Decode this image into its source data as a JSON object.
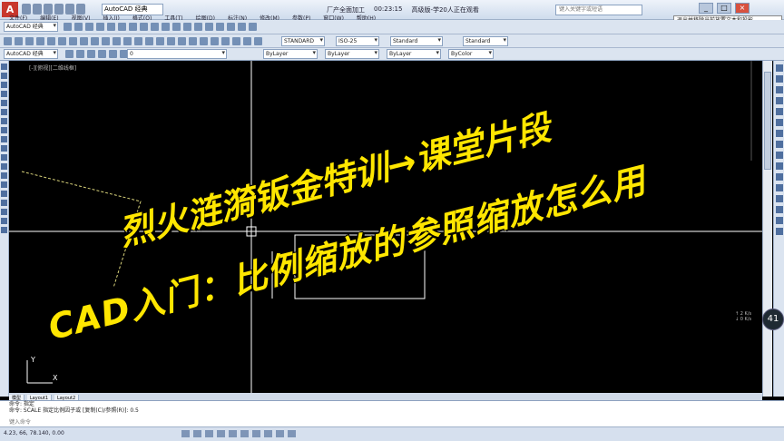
{
  "app": {
    "logo": "A",
    "workspace": "AutoCAD 经典",
    "doc_title": "厂产全面加工",
    "doc_meta": "00:23:15",
    "doc_info": "高级版-学20人正在观看",
    "search_placeholder": "键入关键字或短语",
    "menu": [
      "文件(F)",
      "编辑(E)",
      "视图(V)",
      "插入(I)",
      "格式(O)",
      "工具(T)",
      "绘图(D)",
      "标注(N)",
      "修改(M)",
      "参数(P)",
      "窗口(W)",
      "帮助(H)"
    ],
    "window_buttons": [
      "_",
      "□",
      "×"
    ]
  },
  "toolbars": {
    "workspace_combo": "AutoCAD 经典",
    "text_style": "STANDARD",
    "dim_style": "ISO-25",
    "table_style": "Standard",
    "multileader_style": "Standard",
    "layer": "0",
    "color": "ByLayer",
    "linetype": "ByLayer",
    "lineweight": "ByLayer",
    "plot_style": "ByColor"
  },
  "viewport": {
    "label": "[-][俯视][二维线框]"
  },
  "tooltip": "退出并移除当前放置文本和投影",
  "tabs": [
    "模型",
    "Layout1",
    "Layout2"
  ],
  "command": {
    "history": [
      "命令: 指定",
      "命令: SCALE 指定比例因子或 [复制(C)/参照(R)]: 0.5"
    ],
    "input_placeholder": "键入命令"
  },
  "status": {
    "coords": "4.23, 66, 78.140, 0.00"
  },
  "overlay": {
    "line1": "烈火涟漪钣金特训→课堂片段",
    "line2": "CAD入门：比例缩放的参照缩放怎么用"
  },
  "side_widget": {
    "badge": "41",
    "speed_up": "↑ 2 K/s",
    "speed_down": "↓ 0 K/s"
  },
  "colors": {
    "canvas": "#000000",
    "overlay_text": "#ffe600",
    "crosshair": "#ffffff",
    "dashed_line": "#d8d27a"
  }
}
